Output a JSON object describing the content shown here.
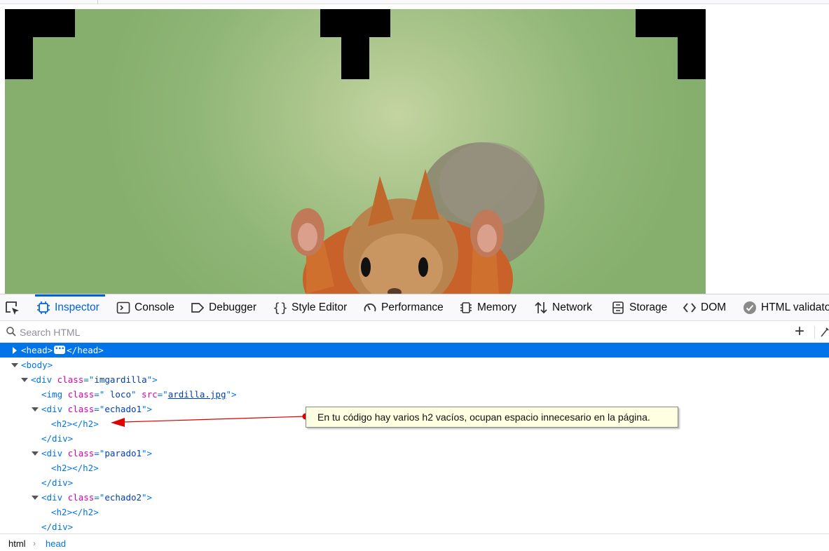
{
  "devtools": {
    "tabs": [
      {
        "label": "Inspector",
        "icon": "inspector-icon",
        "active": true
      },
      {
        "label": "Console",
        "icon": "console-icon"
      },
      {
        "label": "Debugger",
        "icon": "debugger-icon"
      },
      {
        "label": "Style Editor",
        "icon": "braces-icon"
      },
      {
        "label": "Performance",
        "icon": "gauge-icon"
      },
      {
        "label": "Memory",
        "icon": "memory-chip-icon"
      },
      {
        "label": "Network",
        "icon": "up-down-arrows-icon"
      },
      {
        "label": "Storage",
        "icon": "storage-icon"
      },
      {
        "label": "DOM",
        "icon": "chevrons-icon"
      },
      {
        "label": "HTML validato",
        "icon": "check-circle-icon"
      }
    ],
    "search": {
      "placeholder": "Search HTML",
      "value": ""
    },
    "accent_color": "#0074e8"
  },
  "tree": {
    "head_open": "<head>",
    "head_close": "</head>",
    "body_open": "<body>",
    "div_open": "<div ",
    "class_attr": "class",
    "eq_quote": "=\"",
    "close_quote_gt": "\">",
    "imgardilla": "imgardilla",
    "img_open": "<img ",
    "img_class": " loco",
    "src_attr": "src",
    "img_src": "ardilla.jpg",
    "echado1": "echado1",
    "parado1": "parado1",
    "echado2": "echado2",
    "h2": "<h2></h2>",
    "div_close": "</div>"
  },
  "breadcrumbs": [
    "html",
    "head"
  ],
  "annotation": {
    "text": "En tu código hay varios h2 vacíos, ocupan espacio innecesario en la página.",
    "arrow_color": "#e00000",
    "note_bg": "#ffffe1"
  },
  "page": {
    "photo_subject": "squirrel"
  }
}
